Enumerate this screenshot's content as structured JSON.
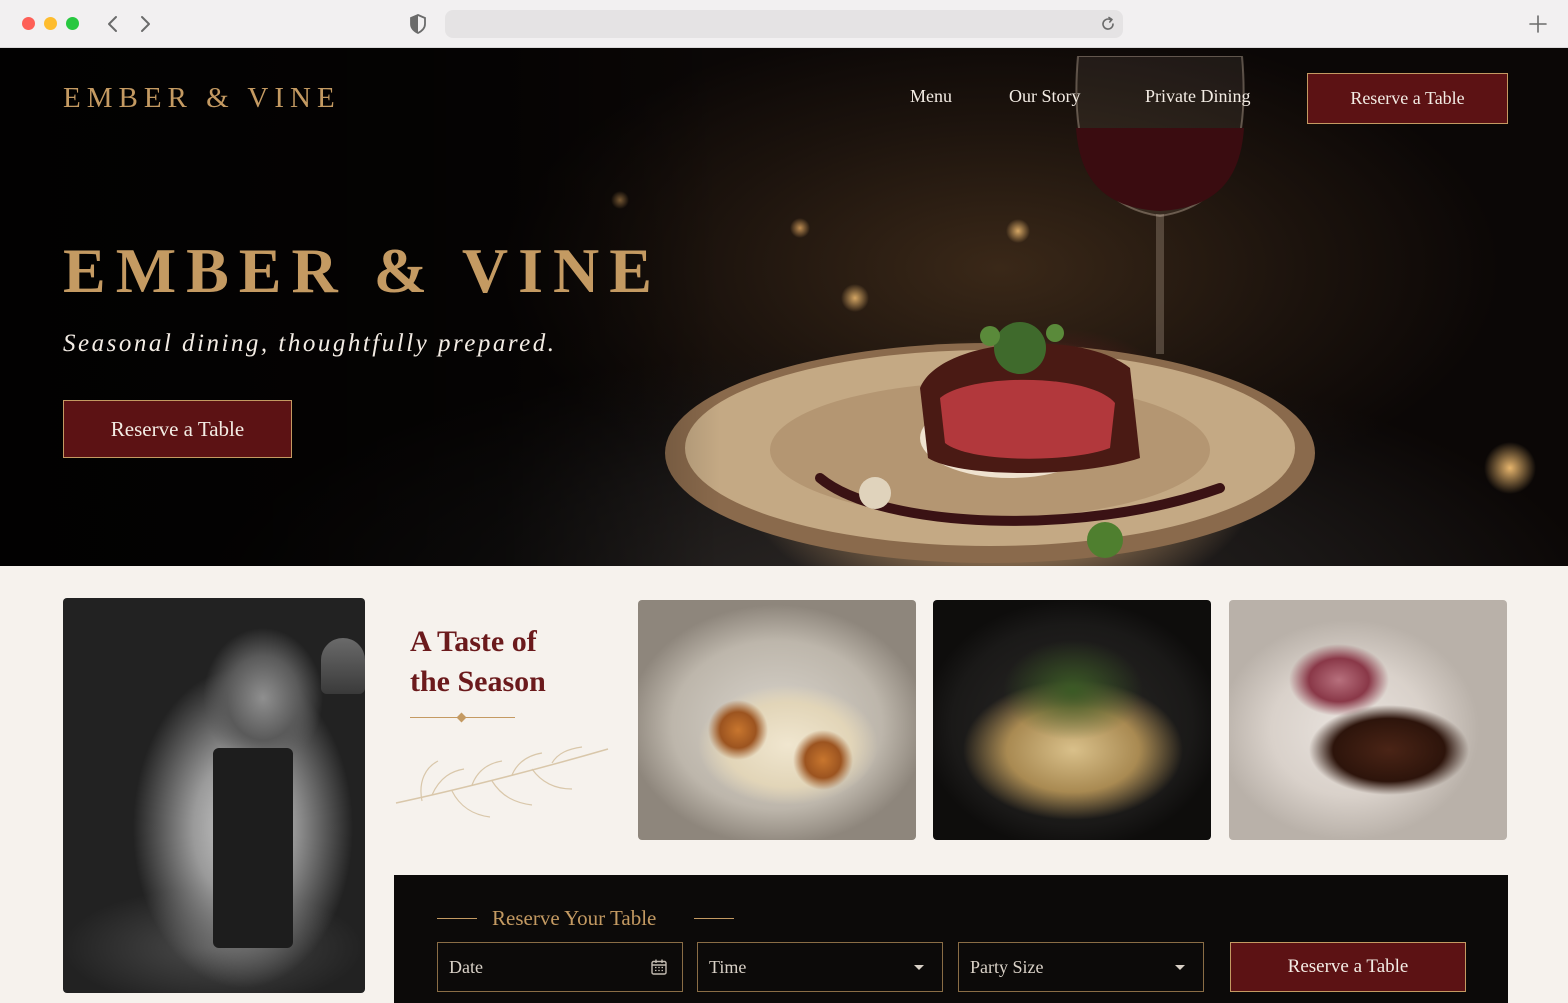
{
  "browser": {
    "url": "",
    "icons": [
      "close-dot",
      "minimize-dot",
      "zoom-dot",
      "back-icon",
      "forward-icon",
      "shield-icon",
      "reload-icon",
      "new-tab-icon"
    ]
  },
  "header": {
    "brand": "EMBER & VINE",
    "nav": {
      "menu": "Menu",
      "story": "Our Story",
      "private": "Private Dining"
    },
    "cta": "Reserve a Table"
  },
  "hero": {
    "title": "EMBER & VINE",
    "subtitle": "Seasonal dining, thoughtfully prepared.",
    "cta": "Reserve a Table"
  },
  "taste": {
    "title_line1": "A Taste of",
    "title_line2": "the Season"
  },
  "reserve": {
    "title": "Reserve Your Table",
    "date_placeholder": "Date",
    "time_placeholder": "Time",
    "party_placeholder": "Party Size",
    "cta": "Reserve a Table"
  },
  "colors": {
    "accent_gold": "#c49a62",
    "burgundy": "#5c1214",
    "heading_red": "#6b1a1c",
    "cream": "#f6f2ed",
    "panel_black": "#0c0a09"
  }
}
